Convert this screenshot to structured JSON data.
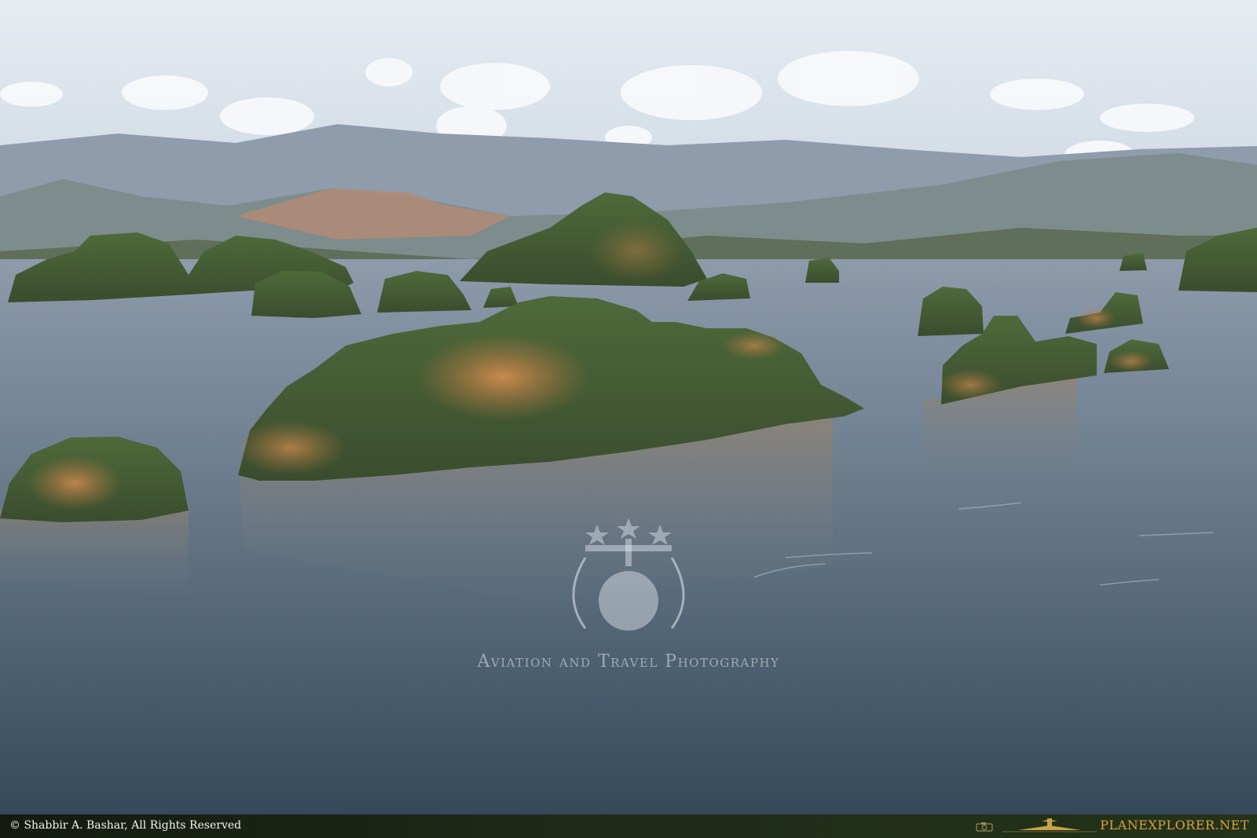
{
  "scene": {
    "subject": "aerial-seascape-limestone-islands"
  },
  "watermark": {
    "text": "Aviation and Travel Photography",
    "logo": "stars-plane-globe-laurel-emblem"
  },
  "footer": {
    "copyright": "© Shabbir A. Bashar, All Rights Reserved",
    "brand": "PLANEXPLORER.NET",
    "camera_icon": "camera-icon",
    "plane_icon": "airplane-icon",
    "brand_color": "#d9a23a"
  }
}
